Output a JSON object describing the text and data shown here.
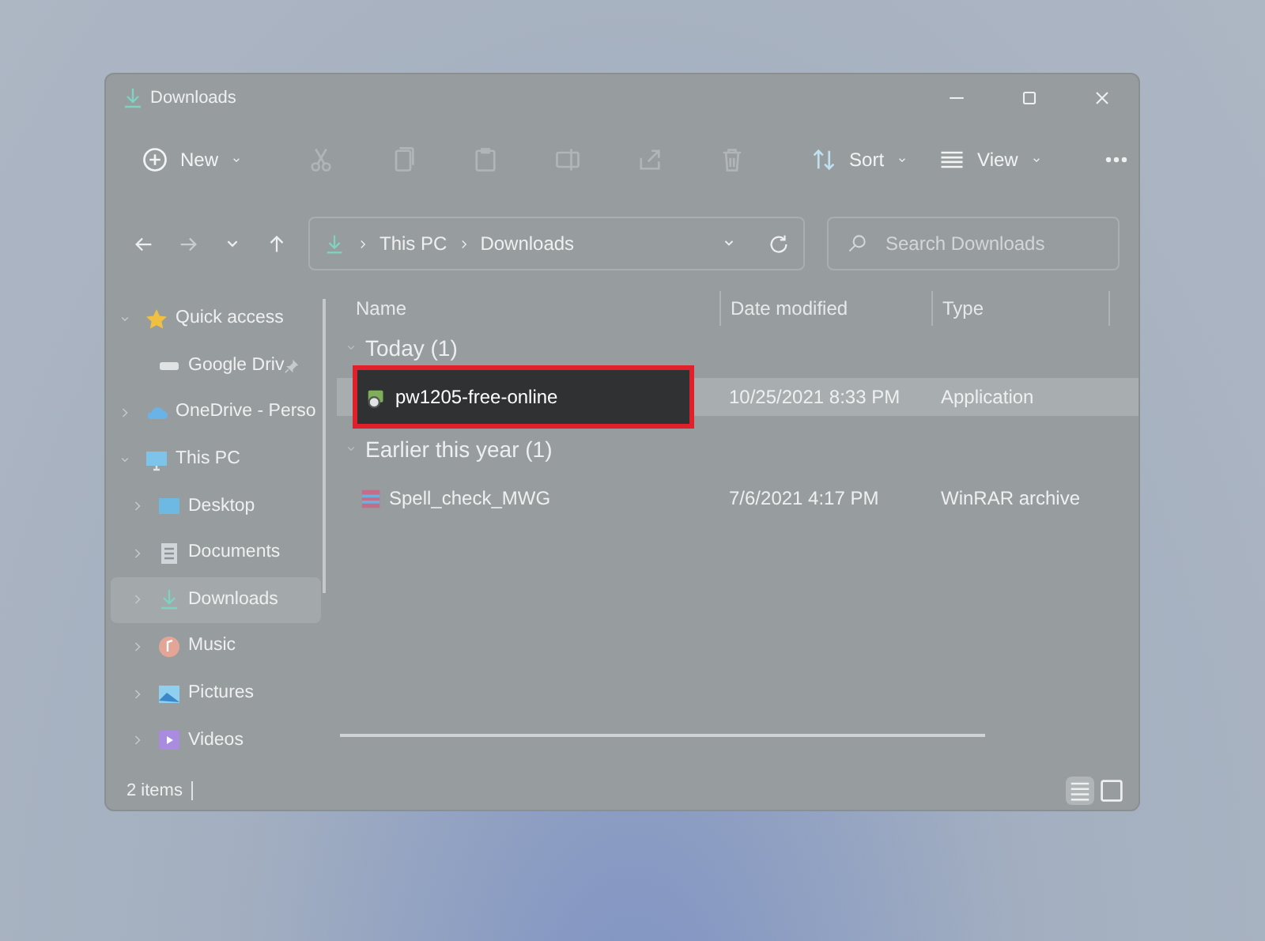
{
  "window": {
    "title": "Downloads"
  },
  "toolbar": [
    {
      "kind": "new",
      "label": "New",
      "disabled": false
    },
    {
      "kind": "cut",
      "disabled": true
    },
    {
      "kind": "copy",
      "disabled": true
    },
    {
      "kind": "paste",
      "disabled": true
    },
    {
      "kind": "rename",
      "disabled": true
    },
    {
      "kind": "share",
      "disabled": true
    },
    {
      "kind": "delete",
      "disabled": true
    },
    {
      "kind": "sort",
      "label": "Sort",
      "disabled": false
    },
    {
      "kind": "view",
      "label": "View",
      "disabled": false
    },
    {
      "kind": "more"
    }
  ],
  "address": {
    "path": [
      "This PC",
      "Downloads"
    ]
  },
  "search": {
    "placeholder": "Search Downloads"
  },
  "sidebar": {
    "items": [
      {
        "label": "Quick access",
        "kind": "star",
        "expanded": true,
        "selected": false,
        "children": [
          {
            "label": "Google Driv",
            "kind": "drive",
            "pinned": true,
            "selected": false
          }
        ]
      },
      {
        "label": "OneDrive - Perso",
        "kind": "cloud",
        "expanded": false,
        "selected": false
      },
      {
        "label": "This PC",
        "kind": "pc",
        "expanded": true,
        "selected": false,
        "children": [
          {
            "label": "Desktop",
            "kind": "desktop",
            "expanded": false,
            "selected": false
          },
          {
            "label": "Documents",
            "kind": "documents",
            "expanded": false,
            "selected": false
          },
          {
            "label": "Downloads",
            "kind": "downloads",
            "expanded": false,
            "selected": true
          },
          {
            "label": "Music",
            "kind": "music",
            "expanded": false,
            "selected": false
          },
          {
            "label": "Pictures",
            "kind": "pictures",
            "expanded": false,
            "selected": false
          },
          {
            "label": "Videos",
            "kind": "videos",
            "expanded": false,
            "selected": false
          }
        ]
      }
    ]
  },
  "table": {
    "columns": [
      "Name",
      "Date modified",
      "Type"
    ],
    "groups": [
      {
        "label": "Today (1)",
        "rows": [
          {
            "name": "pw1205-free-online",
            "date": "10/25/2021 8:33 PM",
            "type": "Application",
            "kind": "app",
            "selected": true,
            "marked": true
          }
        ]
      },
      {
        "label": "Earlier this year (1)",
        "rows": [
          {
            "name": "Spell_check_MWG",
            "date": "7/6/2021 4:17 PM",
            "type": "WinRAR archive",
            "kind": "archive",
            "selected": false,
            "marked": false
          }
        ]
      }
    ]
  },
  "status_bar": {
    "text": "2 items",
    "views": [
      {
        "kind": "details",
        "selected": true
      },
      {
        "kind": "tiles",
        "selected": false
      }
    ]
  }
}
